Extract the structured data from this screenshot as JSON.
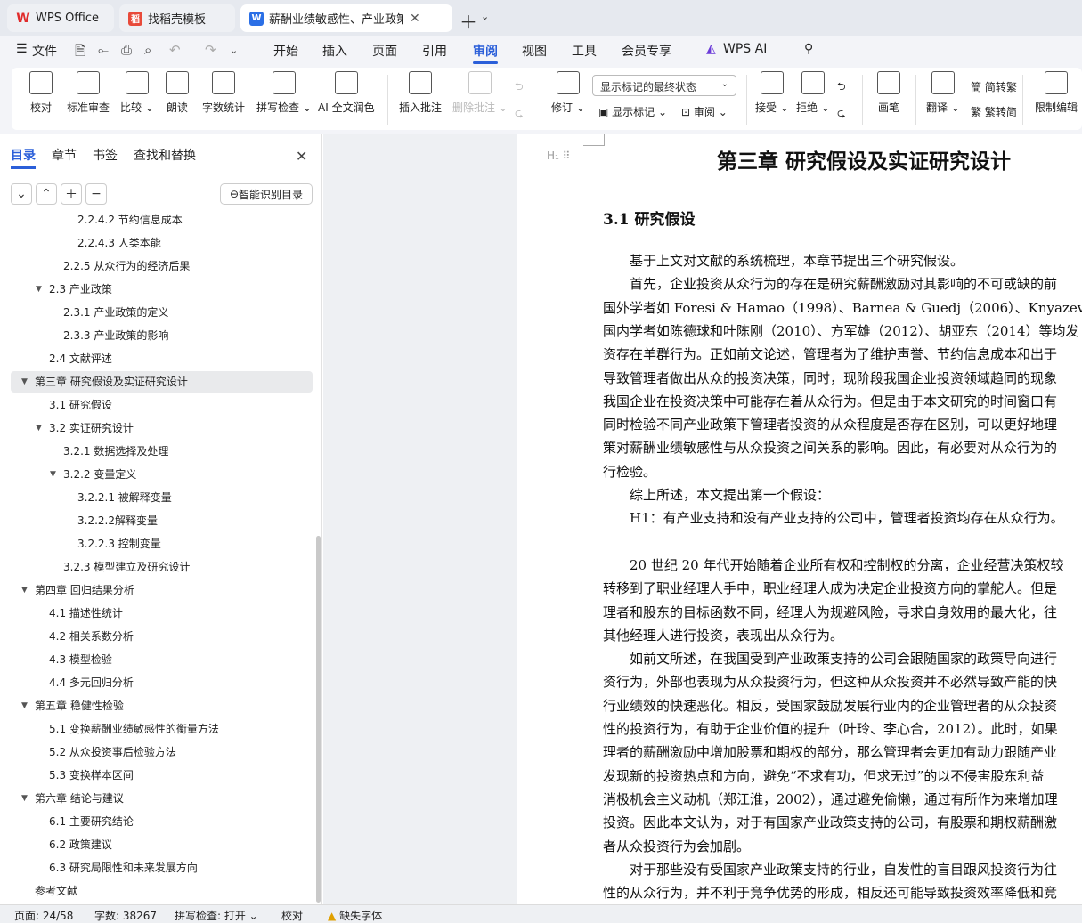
{
  "tabs": {
    "wps": "WPS Office",
    "daoke": "找稻壳模板",
    "doc": "薪酬业绩敏感性、产业政策与企业投资从众行为"
  },
  "menu": {
    "file": "文件",
    "items": [
      "开始",
      "插入",
      "页面",
      "引用",
      "审阅",
      "视图",
      "工具",
      "会员专享"
    ],
    "active": "审阅",
    "ai": "WPS AI"
  },
  "ribbon": {
    "proof": "校对",
    "std_review": "标准审查",
    "compare": "比较",
    "read_aloud": "朗读",
    "word_count": "字数统计",
    "spell_check": "拼写检查",
    "ai_proof": "AI 全文润色",
    "insert_comment": "插入批注",
    "delete_comment": "删除批注",
    "revise": "修订",
    "markup_select": "显示标记的最终状态",
    "show_markup": "显示标记",
    "review": "审阅",
    "accept": "接受",
    "reject": "拒绝",
    "pen": "画笔",
    "translate": "翻译",
    "to_trad": "简转繁",
    "to_simp": "繁转简",
    "restrict": "限制编辑"
  },
  "nav": {
    "tabs": [
      "目录",
      "章节",
      "书签",
      "查找和替换"
    ],
    "smart_toc": "智能识别目录",
    "toc": [
      {
        "label": "2.2.4.2  节约信息成本",
        "level": 4
      },
      {
        "label": "2.2.4.3  人类本能",
        "level": 4
      },
      {
        "label": "2.2.5  从众行为的经济后果",
        "level": 3
      },
      {
        "label": "2.3  产业政策",
        "level": 2,
        "expanded": true
      },
      {
        "label": "2.3.1  产业政策的定义",
        "level": 3
      },
      {
        "label": "2.3.3  产业政策的影响",
        "level": 3
      },
      {
        "label": "2.4  文献评述",
        "level": 2
      },
      {
        "label": "第三章  研究假设及实证研究设计",
        "level": 1,
        "expanded": true,
        "selected": true
      },
      {
        "label": "3.1  研究假设",
        "level": 2
      },
      {
        "label": "3.2  实证研究设计",
        "level": 2,
        "expanded": true
      },
      {
        "label": "3.2.1  数据选择及处理",
        "level": 3
      },
      {
        "label": "3.2.2  变量定义",
        "level": 3,
        "expanded": true
      },
      {
        "label": "3.2.2.1  被解释变量",
        "level": 4
      },
      {
        "label": "3.2.2.2解释变量",
        "level": 4
      },
      {
        "label": "3.2.2.3  控制变量",
        "level": 4
      },
      {
        "label": "3.2.3  模型建立及研究设计",
        "level": 3
      },
      {
        "label": "第四章  回归结果分析",
        "level": 1,
        "expanded": true
      },
      {
        "label": "4.1  描述性统计",
        "level": 2
      },
      {
        "label": "4.2  相关系数分析",
        "level": 2
      },
      {
        "label": "4.3  模型检验",
        "level": 2
      },
      {
        "label": "4.4  多元回归分析",
        "level": 2
      },
      {
        "label": "第五章  稳健性检验",
        "level": 1,
        "expanded": true
      },
      {
        "label": "5.1  变换薪酬业绩敏感性的衡量方法",
        "level": 2
      },
      {
        "label": "5.2  从众投资事后检验方法",
        "level": 2
      },
      {
        "label": "5.3  变换样本区间",
        "level": 2
      },
      {
        "label": "第六章  结论与建议",
        "level": 1,
        "expanded": true
      },
      {
        "label": "6.1  主要研究结论",
        "level": 2
      },
      {
        "label": "6.2  政策建议",
        "level": 2
      },
      {
        "label": "6.3  研究局限性和未来发展方向",
        "level": 2
      },
      {
        "label": "参考文献",
        "level": 1
      }
    ]
  },
  "doc": {
    "heading_marker": "H₁",
    "title": "第三章  研究假设及实证研究设计",
    "section": "3.1  研究假设",
    "lines": [
      "　　基于上文对文献的系统梳理，本章节提出三个研究假设。",
      "　　首先，企业投资从众行为的存在是研究薪酬激励对其影响的不可或缺的前",
      "国外学者如 Foresi & Hamao（1998）、Barnea & Guedj（2006）、Knyazeva 等（",
      "国内学者如陈德球和叶陈刚（2010）、方军雄（2012）、胡亚东（2014）等均发",
      "资存在羊群行为。正如前文论述，管理者为了维护声誉、节约信息成本和出于",
      "导致管理者做出从众的投资决策，同时，现阶段我国企业投资领域趋同的现象",
      "我国企业在投资决策中可能存在着从众行为。但是由于本文研究的时间窗口有",
      "同时检验不同产业政策下管理者投资的从众程度是否存在区别，可以更好地理",
      "策对薪酬业绩敏感性与从众投资之间关系的影响。因此，有必要对从众行为的",
      "行检验。",
      "　　综上所述，本文提出第一个假设：",
      "　　H1：有产业支持和没有产业支持的公司中，管理者投资均存在从众行为。",
      "",
      "　　20 世纪 20 年代开始随着企业所有权和控制权的分离，企业经营决策权较",
      "转移到了职业经理人手中，职业经理人成为决定企业投资方向的掌舵人。但是",
      "理者和股东的目标函数不同，经理人为规避风险，寻求自身效用的最大化，往",
      "其他经理人进行投资，表现出从众行为。",
      "　　如前文所述，在我国受到产业政策支持的公司会跟随国家的政策导向进行",
      "资行为，外部也表现为从众投资行为，但这种从众投资并不必然导致产能的快",
      "行业绩效的快速恶化。相反，受国家鼓励发展行业内的企业管理者的从众投资",
      "性的投资行为，有助于企业价值的提升（叶玲、李心合，2012）。此时，如果",
      "理者的薪酬激励中增加股票和期权的部分，那么管理者会更加有动力跟随产业",
      "发现新的投资热点和方向，避免“不求有功，但求无过”的以不侵害股东利益",
      "消极机会主义动机（郑江淮，2002），通过避免偷懒，通过有所作为来增加理",
      "投资。因此本文认为，对于有国家产业政策支持的公司，有股票和期权薪酬激",
      "者从众投资行为会加剧。",
      "　　对于那些没有受国家产业政策支持的行业，自发性的盲目跟风投资行为往",
      "性的从众行为，并不利于竞争优势的形成，相反还可能导致投资效率降低和竞"
    ]
  },
  "status": {
    "page": "页面: 24/58",
    "words": "字数: 38267",
    "spell": "拼写检查: 打开",
    "proof": "校对",
    "missing_font": "缺失字体"
  }
}
